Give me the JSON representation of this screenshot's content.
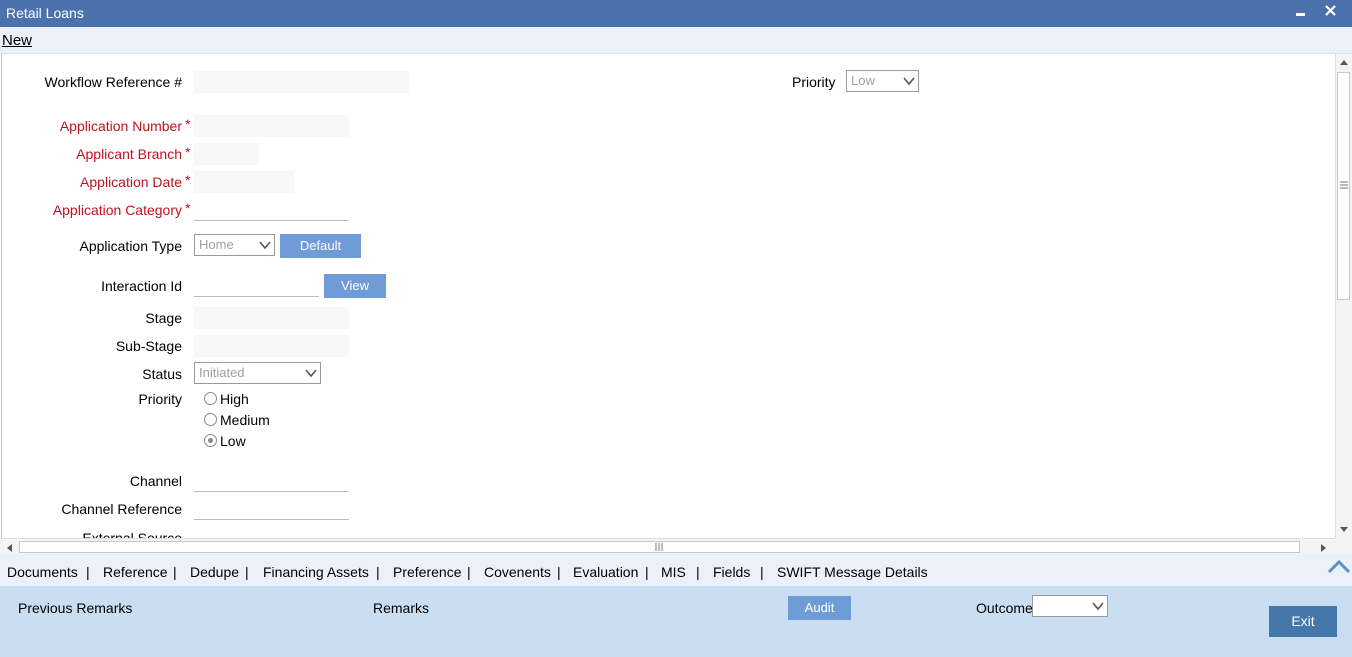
{
  "window": {
    "title": "Retail Loans"
  },
  "menu": {
    "new_label": "New"
  },
  "form": {
    "workflow_ref_label": "Workflow Reference #",
    "priority_top_label": "Priority",
    "priority_top_value": "Low",
    "application_number_label": "Application Number",
    "applicant_branch_label": "Applicant Branch",
    "application_date_label": "Application Date",
    "application_category_label": "Application Category",
    "required_marker": "*",
    "application_type_label": "Application Type",
    "application_type_value": "Home",
    "default_button": "Default",
    "interaction_id_label": "Interaction Id",
    "view_button": "View",
    "stage_label": "Stage",
    "sub_stage_label": "Sub-Stage",
    "status_label": "Status",
    "status_value": "Initiated",
    "priority_label": "Priority",
    "priority_options": [
      "High",
      "Medium",
      "Low"
    ],
    "priority_selected": "Low",
    "channel_label": "Channel",
    "channel_reference_label": "Channel Reference",
    "external_source_label": "External Source"
  },
  "tabs": [
    "Documents",
    "Reference",
    "Dedupe",
    "Financing Assets",
    "Preference",
    "Covenents",
    "Evaluation",
    "MIS",
    "Fields",
    "SWIFT Message Details"
  ],
  "tab_separator": "|",
  "footer": {
    "previous_remarks_label": "Previous Remarks",
    "remarks_label": "Remarks",
    "audit_button": "Audit",
    "outcome_label": "Outcome",
    "exit_button": "Exit"
  },
  "colors": {
    "titlebar": "#4b72ad",
    "required": "#c1121f",
    "button": "#6f9bd7",
    "footer": "#c9dff1",
    "exit": "#4477aa"
  },
  "icons": {
    "minimize": "minimize-icon",
    "close": "close-icon",
    "collapse": "chevron-up-icon"
  }
}
